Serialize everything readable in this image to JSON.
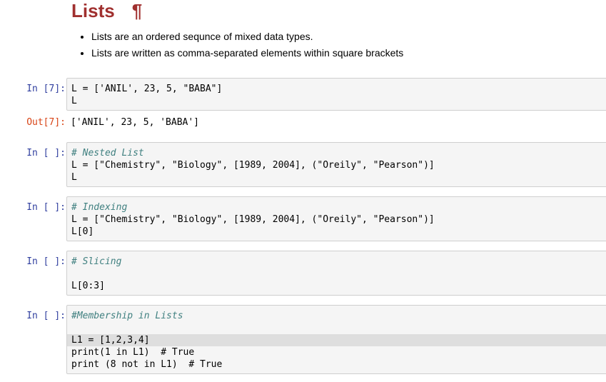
{
  "heading": {
    "title": "Lists",
    "anchor": "¶"
  },
  "bullets": [
    "Lists are an ordered sequnce of mixed data types.",
    "Lists are written as comma-separated elements within square brackets"
  ],
  "cells": [
    {
      "prompt": "In [7]:",
      "lines": [
        "L = ['ANIL', 23, 5, \"BABA\"]",
        "L"
      ]
    },
    {
      "prompt": "Out[7]:",
      "lines": [
        "['ANIL', 23, 5, 'BABA']"
      ]
    },
    {
      "prompt": "In [ ]:",
      "lines": [
        "# Nested List",
        "L = [\"Chemistry\", \"Biology\", [1989, 2004], (\"Oreily\", \"Pearson\")]",
        "L"
      ]
    },
    {
      "prompt": "In [ ]:",
      "lines": [
        "# Indexing",
        "L = [\"Chemistry\", \"Biology\", [1989, 2004], (\"Oreily\", \"Pearson\")]",
        "L[0]"
      ]
    },
    {
      "prompt": "In [ ]:",
      "lines": [
        "# Slicing",
        "",
        "L[0:3]"
      ]
    },
    {
      "prompt": "In [ ]:",
      "lines": [
        "#Membership in Lists",
        "",
        "L1 = [1,2,3,4]",
        "print(1 in L1)  # True",
        "print (8 not in L1)  # True"
      ]
    }
  ],
  "colors": {
    "heading": "#a0302f",
    "prompt_in": "#303f9f",
    "prompt_out": "#d84315",
    "cell_bg": "#f5f5f5"
  }
}
